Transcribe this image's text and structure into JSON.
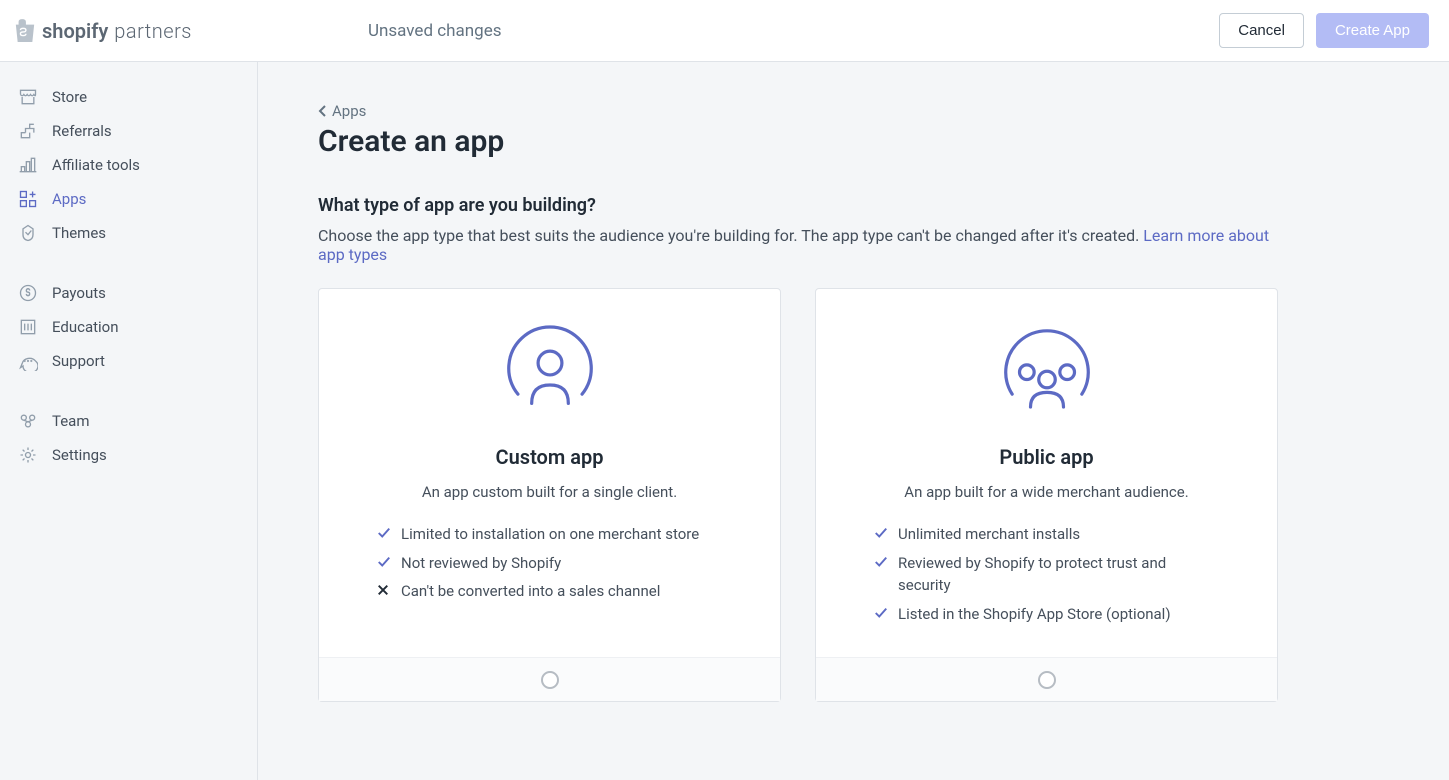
{
  "brand": {
    "name": "shopify",
    "suffix": "partners"
  },
  "topbar": {
    "status": "Unsaved changes",
    "cancel": "Cancel",
    "primary": "Create App"
  },
  "sidebar": {
    "groups": [
      [
        {
          "label": "Store"
        },
        {
          "label": "Referrals"
        },
        {
          "label": "Affiliate tools"
        },
        {
          "label": "Apps",
          "active": true
        },
        {
          "label": "Themes"
        }
      ],
      [
        {
          "label": "Payouts"
        },
        {
          "label": "Education"
        },
        {
          "label": "Support"
        }
      ],
      [
        {
          "label": "Team"
        },
        {
          "label": "Settings"
        }
      ]
    ]
  },
  "breadcrumb": "Apps",
  "page_title": "Create an app",
  "section": {
    "heading": "What type of app are you building?",
    "description": "Choose the app type that best suits the audience you're building for. The app type can't be changed after it's created.",
    "link": "Learn more about app types"
  },
  "cards": {
    "custom": {
      "title": "Custom app",
      "subtitle": "An app custom built for a single client.",
      "features": [
        {
          "icon": "check",
          "text": "Limited to installation on one merchant store"
        },
        {
          "icon": "check",
          "text": "Not reviewed by Shopify"
        },
        {
          "icon": "cross",
          "text": "Can't be converted into a sales channel"
        }
      ]
    },
    "public": {
      "title": "Public app",
      "subtitle": "An app built for a wide merchant audience.",
      "features": [
        {
          "icon": "check",
          "text": "Unlimited merchant installs"
        },
        {
          "icon": "check",
          "text": "Reviewed by Shopify to protect trust and security"
        },
        {
          "icon": "check",
          "text": "Listed in the Shopify App Store (optional)"
        }
      ]
    }
  }
}
